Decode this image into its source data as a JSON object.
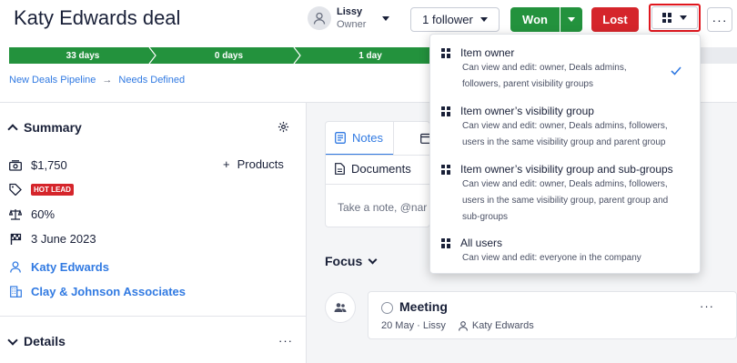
{
  "deal": {
    "title": "Katy Edwards deal"
  },
  "owner": {
    "name": "Lissy",
    "role": "Owner"
  },
  "header": {
    "follower_label": "1 follower",
    "won_label": "Won",
    "lost_label": "Lost",
    "more_label": "···"
  },
  "stages": [
    {
      "label": "33 days",
      "active": true
    },
    {
      "label": "0 days",
      "active": true
    },
    {
      "label": "1 day",
      "active": true
    },
    {
      "label": "",
      "active": false
    }
  ],
  "breadcrumb": {
    "pipeline": "New Deals Pipeline",
    "stage": "Needs Defined",
    "arrow": "→"
  },
  "summary": {
    "heading": "Summary",
    "value": "$1,750",
    "products_label": "Products",
    "label_badge": "HOT LEAD",
    "probability": "60%",
    "close_date": "3 June 2023",
    "person": "Katy Edwards",
    "organization": "Clay & Johnson Associates"
  },
  "details": {
    "heading": "Details",
    "more": "···"
  },
  "tabs": {
    "notes": "Notes",
    "activity": "Ac",
    "documents": "Documents",
    "note_placeholder": "Take a note, @nar"
  },
  "focus": {
    "label": "Focus"
  },
  "activity": {
    "title": "Meeting",
    "date_owner": "20 May · Lissy",
    "person": "Katy Edwards",
    "more": "···"
  },
  "visibility_menu": {
    "options": [
      {
        "title": "Item owner",
        "desc": [
          "Can view and edit: owner, Deals admins,",
          "followers, parent visibility groups"
        ],
        "selected": true
      },
      {
        "title": "Item owner’s visibility group",
        "desc": [
          "Can view and edit: owner, Deals admins, followers,",
          "users in the same visibility group and parent group"
        ],
        "selected": false
      },
      {
        "title": "Item owner’s visibility group and sub-groups",
        "desc": [
          "Can view and edit: owner, Deals admins, followers,",
          "users in the same visibility group, parent group and",
          "sub-groups"
        ],
        "selected": false
      },
      {
        "title": "All users",
        "desc": [
          "Can view and edit: everyone in the company"
        ],
        "selected": false
      }
    ]
  },
  "colors": {
    "primary": "#317ae2",
    "won": "#23923d",
    "lost": "#d5252b",
    "highlight": "#e0161e"
  }
}
